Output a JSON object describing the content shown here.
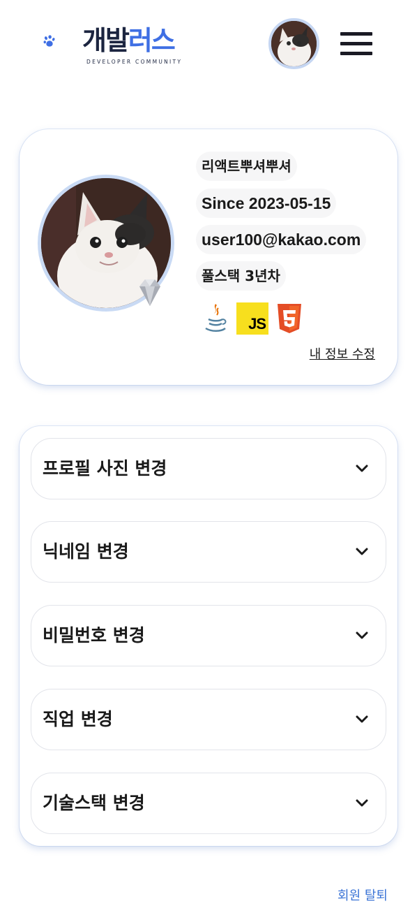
{
  "header": {
    "logo_text_dark": "개발",
    "logo_text_blue": "러스",
    "logo_subtitle": "DEVELOPER COMMUNITY",
    "logo_color": "#3f6fe4",
    "menu_icon": "hamburger-menu-icon"
  },
  "profile": {
    "nickname": "리액트뿌셔뿌셔",
    "since": "Since 2023-05-15",
    "email": "user100@kakao.com",
    "job": "풀스택 3년차",
    "badge_icon": "diamond-icon",
    "tech_stack": [
      "java-icon",
      "javascript-icon",
      "html5-icon"
    ],
    "js_label": "JS",
    "edit_label": "내 정보 수정"
  },
  "settings": {
    "items": [
      {
        "label": "프로필 사진 변경"
      },
      {
        "label": "닉네임 변경"
      },
      {
        "label": "비밀번호 변경"
      },
      {
        "label": "직업 변경"
      },
      {
        "label": "기술스택 변경"
      }
    ],
    "chevron_icon": "chevron-down-icon"
  },
  "footer": {
    "withdraw_label": "회원 탈퇴",
    "withdraw_color": "#3b74d6"
  }
}
